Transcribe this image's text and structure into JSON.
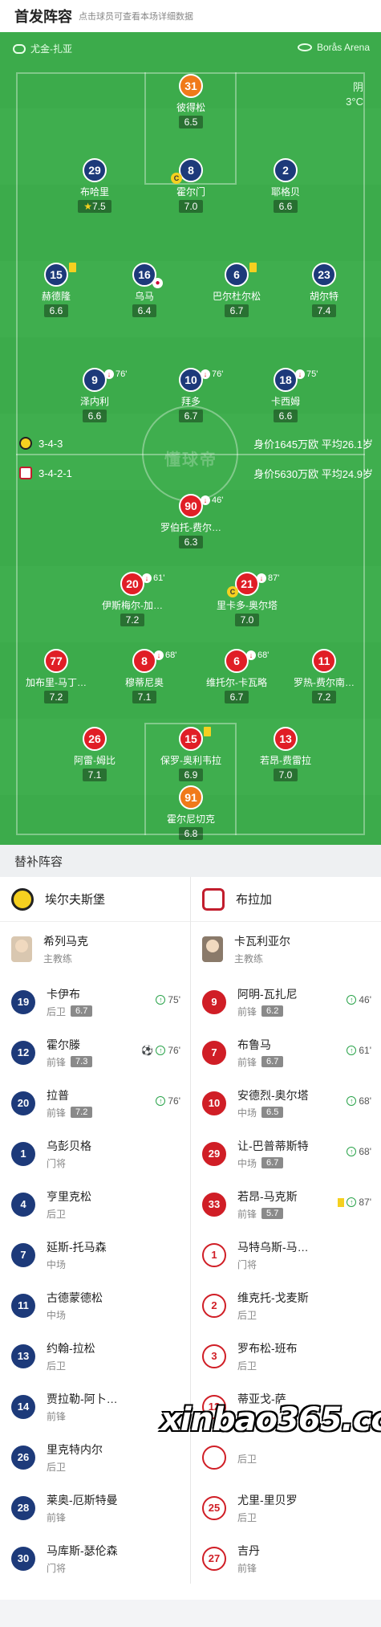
{
  "header": {
    "title": "首发阵容",
    "hint": "点击球员可查看本场详细数据"
  },
  "venue": {
    "city": "尤金-扎亚",
    "stadium": "Borås Arena"
  },
  "weather": {
    "condition": "阴",
    "temperature": "3°C"
  },
  "home_team": {
    "name": "埃尔夫斯堡",
    "formation": "3-4-3",
    "value": "身价1645万欧",
    "age": "平均26.1岁"
  },
  "away_team": {
    "name": "布拉加",
    "formation": "3-4-2-1",
    "value": "身价5630万欧",
    "age": "平均24.9岁"
  },
  "pitch_watermark": "懂球帝",
  "home_players": [
    {
      "num": "31",
      "name": "彼得松",
      "rating": "6.5"
    },
    {
      "num": "29",
      "name": "布哈里",
      "rating": "7.5",
      "star": true
    },
    {
      "num": "8",
      "name": "霍尔门",
      "rating": "7.0"
    },
    {
      "num": "2",
      "name": "耶格贝",
      "rating": "6.6"
    },
    {
      "num": "15",
      "name": "赫德隆",
      "rating": "6.6"
    },
    {
      "num": "16",
      "name": "乌马",
      "rating": "6.4"
    },
    {
      "num": "6",
      "name": "巴尔杜尔松",
      "rating": "6.7"
    },
    {
      "num": "23",
      "name": "胡尔特",
      "rating": "7.4"
    },
    {
      "num": "9",
      "name": "泽内利",
      "rating": "6.6",
      "sub": "76'"
    },
    {
      "num": "10",
      "name": "拜多",
      "rating": "6.7",
      "sub": "76'"
    },
    {
      "num": "18",
      "name": "卡西姆",
      "rating": "6.6",
      "sub": "75'"
    }
  ],
  "away_players": [
    {
      "num": "90",
      "name": "罗伯托-费尔…",
      "rating": "6.3",
      "sub": "46'"
    },
    {
      "num": "20",
      "name": "伊斯梅尔-加…",
      "rating": "7.2",
      "sub": "61'"
    },
    {
      "num": "21",
      "name": "里卡多-奥尔塔",
      "rating": "7.0",
      "sub": "87'"
    },
    {
      "num": "77",
      "name": "加布里-马丁…",
      "rating": "7.2"
    },
    {
      "num": "8",
      "name": "穆蒂尼奥",
      "rating": "7.1",
      "sub": "68'"
    },
    {
      "num": "6",
      "name": "维托尔-卡瓦略",
      "rating": "6.7",
      "sub": "68'"
    },
    {
      "num": "11",
      "name": "罗热-费尔南…",
      "rating": "7.2"
    },
    {
      "num": "26",
      "name": "阿雷-姆比",
      "rating": "7.1"
    },
    {
      "num": "15",
      "name": "保罗-奥利韦拉",
      "rating": "6.9"
    },
    {
      "num": "13",
      "name": "若昂-费雷拉",
      "rating": "7.0"
    },
    {
      "num": "91",
      "name": "霍尔尼切克",
      "rating": "6.8"
    }
  ],
  "subs_title": "替补阵容",
  "home_coach": {
    "name": "希列马克",
    "role": "主教练"
  },
  "away_coach": {
    "name": "卡瓦利亚尔",
    "role": "主教练"
  },
  "home_subs": [
    {
      "num": "19",
      "name": "卡伊布",
      "pos": "后卫",
      "rating": "6.7",
      "event": "75'"
    },
    {
      "num": "12",
      "name": "霍尔滕",
      "pos": "前锋",
      "rating": "7.3",
      "event": "76'"
    },
    {
      "num": "20",
      "name": "拉普",
      "pos": "前锋",
      "rating": "7.2",
      "event": "76'"
    },
    {
      "num": "1",
      "name": "乌彭贝格",
      "pos": "门将"
    },
    {
      "num": "4",
      "name": "亨里克松",
      "pos": "后卫"
    },
    {
      "num": "7",
      "name": "延斯-托马森",
      "pos": "中场"
    },
    {
      "num": "11",
      "name": "古德蒙德松",
      "pos": "中场"
    },
    {
      "num": "13",
      "name": "约翰-拉松",
      "pos": "后卫"
    },
    {
      "num": "14",
      "name": "贾拉勒-阿卜…",
      "pos": "前锋"
    },
    {
      "num": "26",
      "name": "里克特内尔",
      "pos": "后卫"
    },
    {
      "num": "28",
      "name": "莱奥-厄斯特曼",
      "pos": "前锋"
    },
    {
      "num": "30",
      "name": "马库斯-瑟伦森",
      "pos": "门将"
    }
  ],
  "away_subs": [
    {
      "num": "9",
      "name": "阿明-瓦扎尼",
      "pos": "前锋",
      "rating": "6.2",
      "event": "46'"
    },
    {
      "num": "7",
      "name": "布鲁马",
      "pos": "前锋",
      "rating": "6.7",
      "event": "61'"
    },
    {
      "num": "10",
      "name": "安德烈-奥尔塔",
      "pos": "中场",
      "rating": "6.5",
      "event": "68'"
    },
    {
      "num": "29",
      "name": "让-巴普蒂斯特",
      "pos": "中场",
      "rating": "6.7",
      "event": "68'"
    },
    {
      "num": "33",
      "name": "若昂-马克斯",
      "pos": "前锋",
      "rating": "5.7",
      "event": "87'"
    },
    {
      "num": "1",
      "name": "马特乌斯-马…",
      "pos": "门将"
    },
    {
      "num": "2",
      "name": "维克托-戈麦斯",
      "pos": "后卫"
    },
    {
      "num": "3",
      "name": "罗布松-班布",
      "pos": "后卫"
    },
    {
      "num": "12",
      "name": "蒂亚戈-萨",
      "pos": "门将"
    },
    {
      "num": "",
      "name": "",
      "pos": "后卫"
    },
    {
      "num": "25",
      "name": "尤里-里贝罗",
      "pos": "后卫"
    },
    {
      "num": "27",
      "name": "吉丹",
      "pos": "前锋"
    }
  ],
  "watermark": "xinbao365.cc"
}
